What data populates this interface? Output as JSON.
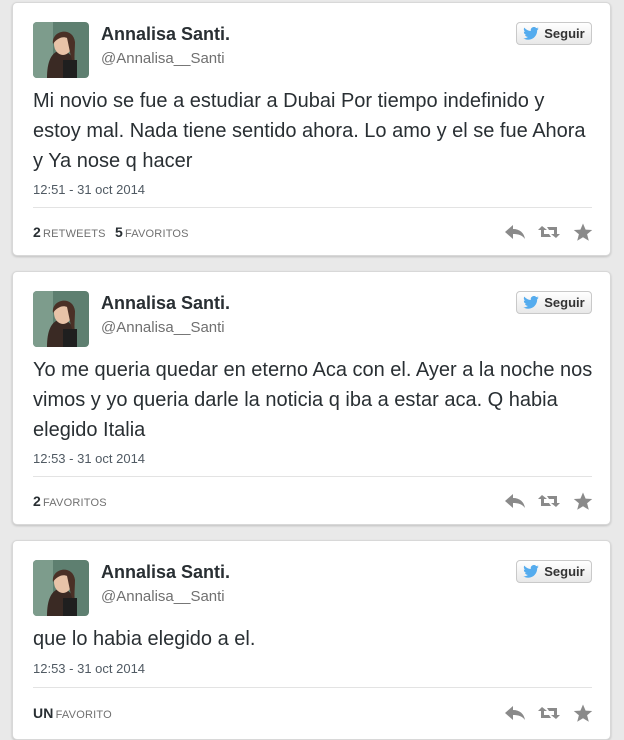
{
  "colors": {
    "icon": "#8a8a8a",
    "twitter_blue": "#55acee"
  },
  "tweets": [
    {
      "name": "Annalisa Santi.",
      "handle": "@Annalisa__Santi",
      "follow_label": "Seguir",
      "text": "Mi novio se fue a estudiar a Dubai Por tiempo indefinido y estoy mal. Nada tiene sentido ahora. Lo amo y el se fue Ahora y Ya nose q hacer",
      "timestamp": "12:51 - 31 oct 2014",
      "stats": [
        {
          "count": "2",
          "label": "RETWEETS"
        },
        {
          "count": "5",
          "label": "FAVORITOS"
        }
      ]
    },
    {
      "name": "Annalisa Santi.",
      "handle": "@Annalisa__Santi",
      "follow_label": "Seguir",
      "text": "Yo me queria quedar en eterno Aca con el. Ayer a la noche nos vimos y yo queria darle la noticia q iba a estar aca. Q habia elegido Italia",
      "timestamp": "12:53 - 31 oct 2014",
      "stats": [
        {
          "count": "2",
          "label": "FAVORITOS"
        }
      ]
    },
    {
      "name": "Annalisa Santi.",
      "handle": "@Annalisa__Santi",
      "follow_label": "Seguir",
      "text": "que lo habia elegido a el.",
      "timestamp": "12:53 - 31 oct 2014",
      "stats": [
        {
          "count": "UN",
          "label": "FAVORITO"
        }
      ]
    }
  ]
}
